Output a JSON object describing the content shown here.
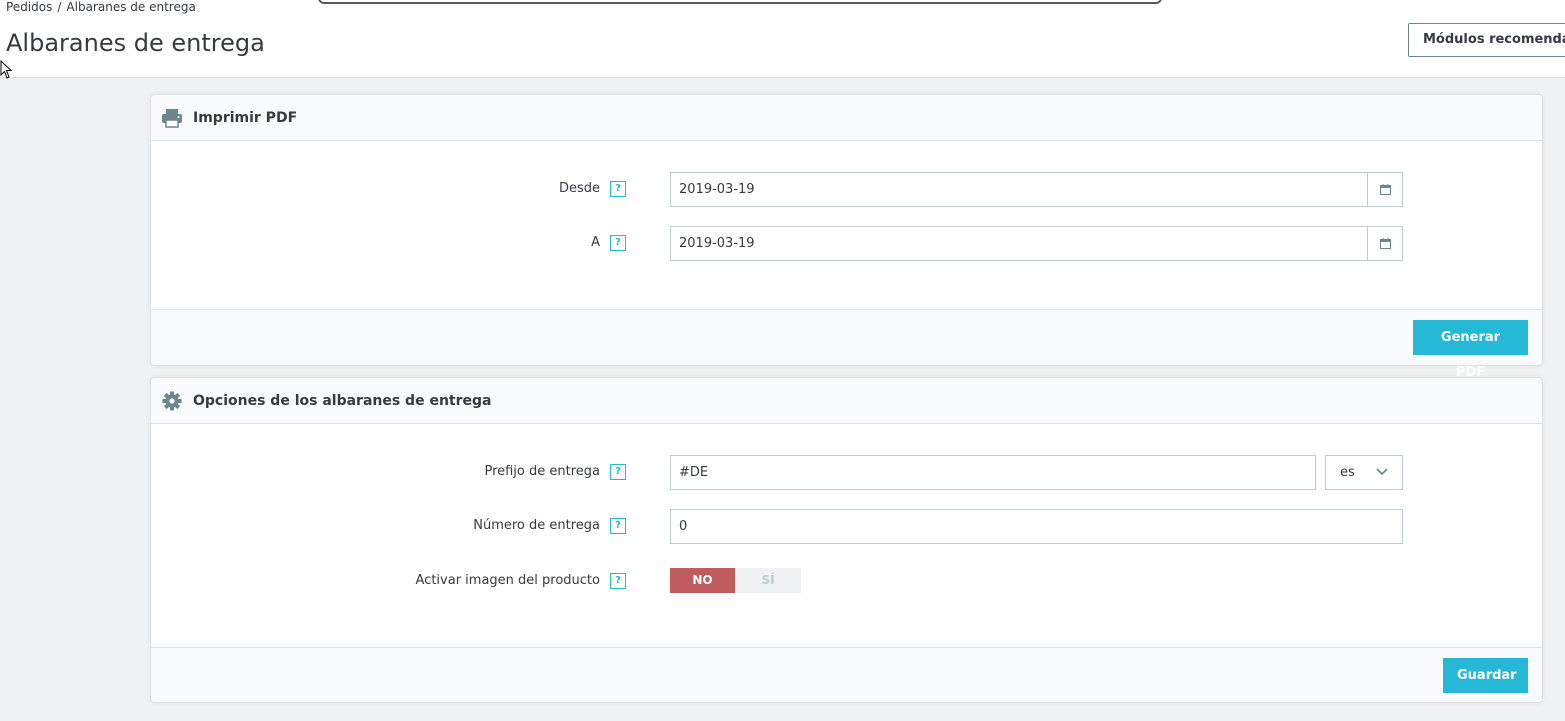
{
  "header": {
    "breadcrumb": [
      "Pedidos",
      "Albaranes de entrega"
    ],
    "breadcrumb_separator": "/",
    "title": "Albaranes de entrega",
    "recommended_modules_label": "Módulos recomendados"
  },
  "print_panel": {
    "title": "Imprimir PDF",
    "icon": "printer-icon",
    "fields": {
      "from_label": "Desde",
      "from_value": "2019-03-19",
      "to_label": "A",
      "to_value": "2019-03-19"
    },
    "help_glyph": "?",
    "generate_label": "Generar PDF"
  },
  "options_panel": {
    "title": "Opciones de los albaranes de entrega",
    "icon": "gear-icon",
    "prefix_label": "Prefijo de entrega",
    "prefix_value": "#DE",
    "language_value": "es",
    "number_label": "Número de entrega",
    "number_value": "0",
    "product_image_label": "Activar imagen del producto",
    "switch_no": "NO",
    "switch_yes": "SÍ",
    "switch_selected": "NO",
    "save_label": "Guardar"
  },
  "colors": {
    "primary": "#25b9d7",
    "danger": "#c05c5e",
    "text": "#363a41",
    "border": "#bbcdd2",
    "background": "#eff1f2"
  }
}
